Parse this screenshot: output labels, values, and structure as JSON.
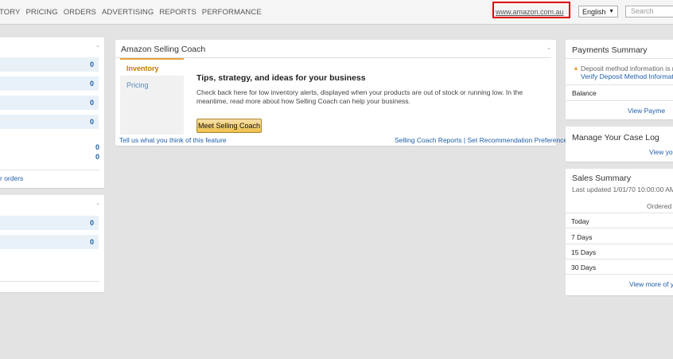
{
  "nav": {
    "items": [
      "TORY",
      "PRICING",
      "ORDERS",
      "ADVERTISING",
      "REPORTS",
      "PERFORMANCE"
    ]
  },
  "header": {
    "marketplace_link": "www.amazon.com.au",
    "language": "English",
    "search_placeholder": "Search",
    "highlight_color": "#e00000"
  },
  "left_card1": {
    "counts": [
      "0",
      "0",
      "0",
      "0",
      "0",
      "0"
    ],
    "link_partial": "r orders"
  },
  "left_card2": {
    "counts": [
      "0",
      "0"
    ]
  },
  "coach": {
    "title": "Amazon Selling Coach",
    "tabs": [
      "Inventory",
      "Pricing"
    ],
    "heading": "Tips, strategy, and ideas for your business",
    "body": "Check back here for low inventory alerts, displayed when your products are out of stock or running low. In the meantime, read more about how Selling Coach can help your business.",
    "button": "Meet Selling Coach",
    "feedback_link": "Tell us what you think of this feature",
    "reports_link": "Selling Coach Reports | Set Recommendation Preferences",
    "accent_color": "#e7a33a"
  },
  "payments": {
    "title": "Payments Summary",
    "alert": "Deposit method information is mis",
    "alert_link": "Verify Deposit Method Information",
    "balance_label": "Balance",
    "view_link": "View Payme"
  },
  "case_log": {
    "title": "Manage Your Case Log",
    "view_link": "View yo"
  },
  "sales": {
    "title": "Sales Summary",
    "updated": "Last updated 1/01/70 10:00:00 AM",
    "col_header": "Ordered",
    "rows": [
      "Today",
      "7 Days",
      "15 Days",
      "30 Days"
    ],
    "view_link": "View more of y"
  }
}
